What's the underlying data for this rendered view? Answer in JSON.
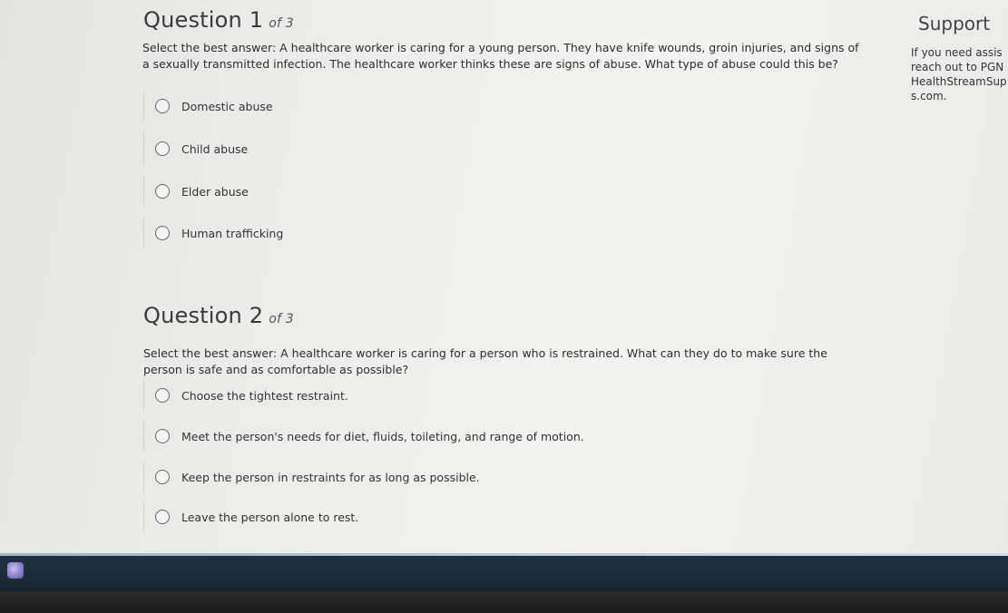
{
  "questions": [
    {
      "title": "Question 1",
      "of": "of 3",
      "text_line1": "Select the best answer: A healthcare worker is caring for a young person. They have knife wounds, groin injuries, and signs of",
      "text_line2": "a sexually transmitted infection. The healthcare worker thinks these are signs of abuse. What type of abuse could this be?",
      "options": [
        "Domestic abuse",
        "Child abuse",
        "Elder abuse",
        "Human trafficking"
      ]
    },
    {
      "title": "Question 2",
      "of": "of 3",
      "text_line1": "Select the best answer: A healthcare worker is caring for a person who is restrained. What can they do to make sure the",
      "text_line2": "person is safe and as comfortable as possible?",
      "options": [
        "Choose the tightest restraint.",
        "Meet the person's needs for diet, fluids, toileting, and range of motion.",
        "Keep the person in restraints for as long as possible.",
        "Leave the person alone to rest."
      ]
    }
  ],
  "support": {
    "title": "Support",
    "text": "If you need assis\nreach out to PGN\nHealthStreamSup\ns.com."
  },
  "taskbar": {
    "icon": "app-icon"
  }
}
